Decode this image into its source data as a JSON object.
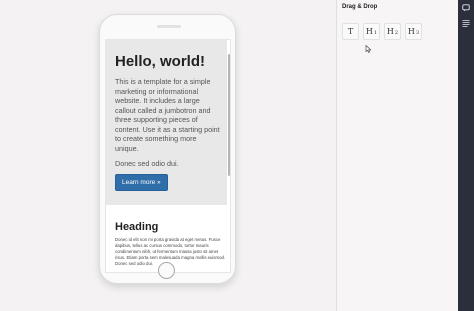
{
  "canvas": {
    "jumbotron": {
      "title": "Hello, world!",
      "text": "This is a template for a simple marketing or informational website. It includes a large callout called a jumbotron and three supporting pieces of content. Use it as a starting point to create something more unique.",
      "subtext": "Donec sed odio dui.",
      "button_label": "Learn more »"
    },
    "section": {
      "heading": "Heading",
      "text": "Donec id elit non mi porta gravida at eget metus. Fusce dapibus, tellus ac cursus commodo, tortor mauris condimentum nibh, ut fermentum massa justo sit amet risus. Etiam porta sem malesuada magna mollis euismod. Donec sed odio dui."
    }
  },
  "panel": {
    "title": "Drag & Drop",
    "tools": [
      {
        "main": "T",
        "sub": ""
      },
      {
        "main": "H",
        "sub": "1"
      },
      {
        "main": "H",
        "sub": "2"
      },
      {
        "main": "H",
        "sub": "3"
      }
    ]
  },
  "rail": {
    "icons": [
      "comment-icon",
      "menu-lines-icon"
    ]
  },
  "colors": {
    "button": "#2f6ea8",
    "jumbotron_bg": "#e9e8e8",
    "rail_bg": "#2b2f3c"
  }
}
